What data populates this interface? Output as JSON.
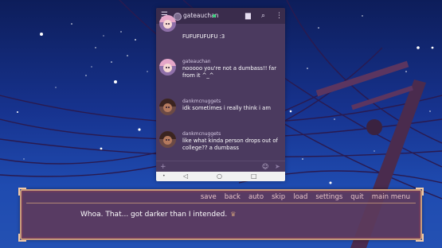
{
  "phone": {
    "contact_name": "gateauchan",
    "icons": {
      "menu": "hamburger-menu-icon",
      "chat": "chat-bubble-icon",
      "search": "search-icon",
      "more": "more-vertical-icon",
      "add": "plus-icon",
      "emoji": "emoji-icon",
      "send": "send-icon"
    },
    "messages": [
      {
        "user": "",
        "text": "FUFUFUFUFU :3",
        "avatar": "gate"
      },
      {
        "user": "gateauchan",
        "text": "nooooo you're not a dumbass!! far from it ^_^",
        "avatar": "gate"
      },
      {
        "user": "dankmcnuggets",
        "text": "idk sometimes i really think i am",
        "avatar": "donk"
      },
      {
        "user": "dankmcnuggets",
        "text": "like what kinda person drops out of college?? a dumbass",
        "avatar": "donk"
      }
    ],
    "nav": {
      "dot": "•",
      "back": "◁",
      "home": "○",
      "recent": "□"
    }
  },
  "quick_menu": [
    "save",
    "back",
    "auto",
    "skip",
    "load",
    "settings",
    "quit",
    "main menu"
  ],
  "dialogue": {
    "text": "Whoa. That... got darker than I intended."
  },
  "colors": {
    "sky_top": "#0d1d5a",
    "sky_bottom": "#2451b3",
    "phone_bg": "#4b3a5f",
    "dialogue_bg": "#5c3a5c",
    "dialogue_border": "#c99a7a",
    "menu_text": "#e7c3c7",
    "online": "#33d37a"
  }
}
